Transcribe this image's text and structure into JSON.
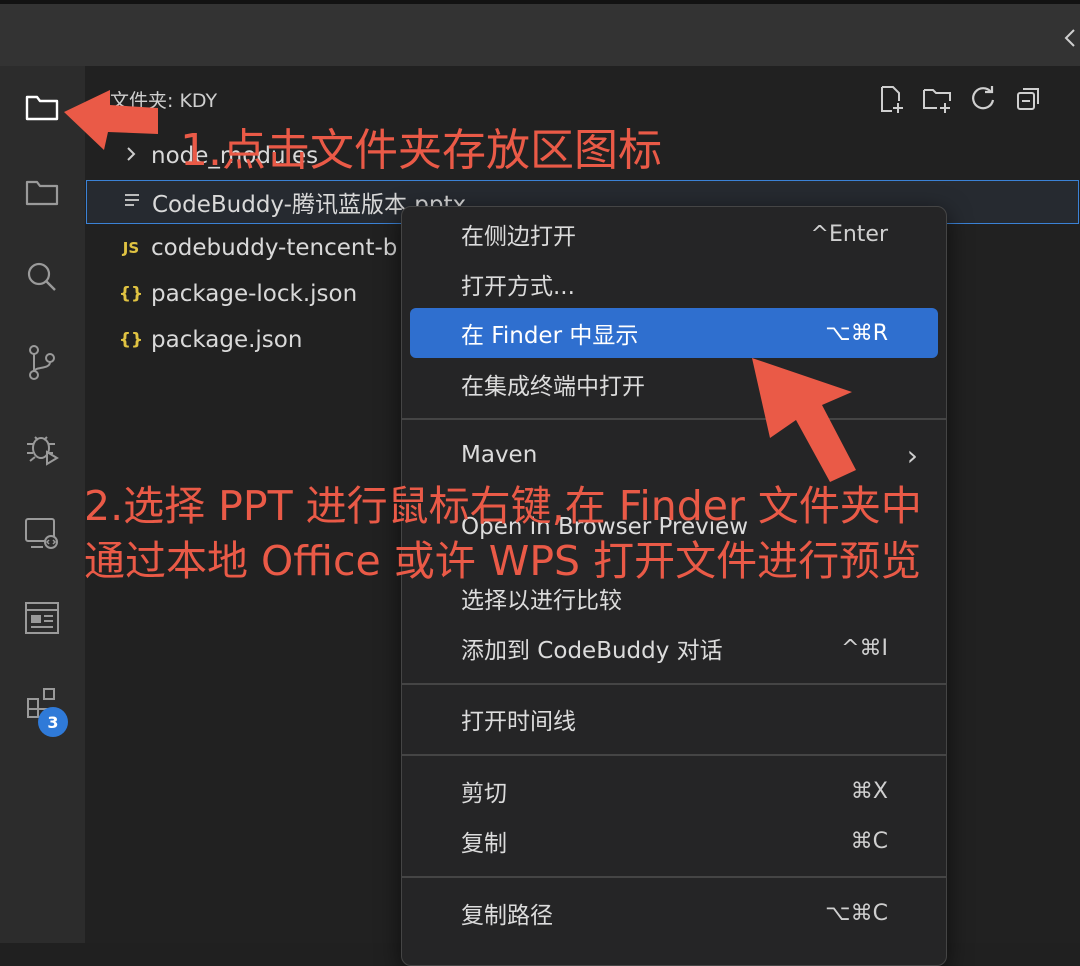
{
  "explorer": {
    "title": "文件夹: KDY",
    "items": [
      {
        "icon": "chevron-right-icon",
        "label": "node_modules"
      },
      {
        "icon": "file-lines-icon",
        "label": "CodeBuddy-腾讯蓝版本.pptx"
      },
      {
        "icon": "js-icon",
        "label": "codebuddy-tencent-b"
      },
      {
        "icon": "json-icon",
        "label": "package-lock.json"
      },
      {
        "icon": "json-icon",
        "label": "package.json"
      }
    ],
    "js_glyph": "JS",
    "json_glyph": "{}"
  },
  "activity_bar": {
    "icons": [
      "folder-icon",
      "folder-icon",
      "search-icon",
      "source-control-icon",
      "debug-icon",
      "remote-explorer-icon",
      "browser-icon",
      "extensions-icon"
    ],
    "extensions_badge": "3"
  },
  "context_menu": {
    "items": [
      {
        "label": "在侧边打开",
        "shortcut": "^Enter"
      },
      {
        "label": "打开方式...",
        "shortcut": ""
      },
      {
        "label": "在 Finder 中显示",
        "shortcut": "⌥⌘R"
      },
      {
        "label": "在集成终端中打开",
        "shortcut": ""
      },
      {
        "label": "Maven",
        "shortcut": "›"
      },
      {
        "label": "Open in Browser Preview",
        "shortcut": ""
      },
      {
        "label": "选择以进行比较",
        "shortcut": ""
      },
      {
        "label": "添加到 CodeBuddy 对话",
        "shortcut": "^⌘I"
      },
      {
        "label": "打开时间线",
        "shortcut": ""
      },
      {
        "label": "剪切",
        "shortcut": "⌘X"
      },
      {
        "label": "复制",
        "shortcut": "⌘C"
      },
      {
        "label": "复制路径",
        "shortcut": "⌥⌘C"
      }
    ]
  },
  "annotations": {
    "step1": "1.点击文件夹存放区图标",
    "step2_line1": "2.选择 PPT 进行鼠标右键,在 Finder 文件夹中",
    "step2_line2": "通过本地 Office 或许 WPS 打开文件进行预览"
  },
  "colors": {
    "accent": "#2f6fcf",
    "annotation": "#ea5a47",
    "badge": "#2f7ad8",
    "json_icon": "#e0c342"
  }
}
